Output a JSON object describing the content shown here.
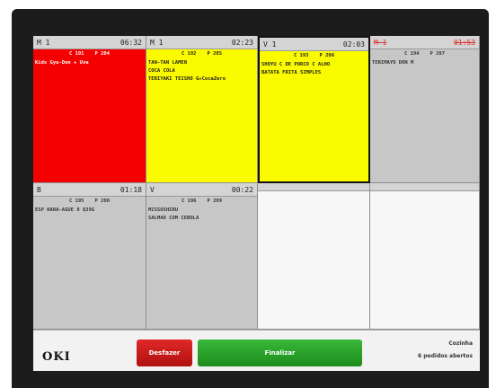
{
  "orders": [
    {
      "header_left": "M 1",
      "header_time": "06:32",
      "client": "C 191",
      "order": "P 204",
      "items": [
        "Kids Gyu-Don + Uva"
      ]
    },
    {
      "header_left": "M 1",
      "header_time": "02:23",
      "client": "C 192",
      "order": "P 205",
      "items": [
        "TAN-TAN LAMEN",
        "COCA COLA",
        "TERIYAKI TEISHO G+CocaZero"
      ]
    },
    {
      "header_left": "V 1",
      "header_time": "02:03",
      "client": "C 193",
      "order": "P 206",
      "items": [
        "SHOYU C DE PORCO C ALHO",
        "BATATA FRITA SIMPLES"
      ]
    },
    {
      "header_left": "M 1",
      "header_time": "01:53",
      "client": "C 194",
      "order": "P 207",
      "items": [
        "TERIMAYO DON M"
      ]
    },
    {
      "header_left": "B",
      "header_time": "01:18",
      "client": "C 195",
      "order": "P 208",
      "items": [
        "ESP KARA-AGUE 8 Q39G"
      ]
    },
    {
      "header_left": "V",
      "header_time": "00:22",
      "client": "C 196",
      "order": "P 209",
      "items": [
        "MISSOSHIRU",
        "SALMAO COM CEBOLA"
      ]
    }
  ],
  "footer": {
    "logo": "OKI",
    "undo_label": "Desfazer",
    "finish_label": "Finalizar",
    "station": "Cozinha",
    "open_orders": "6 pedidos abertos"
  },
  "colors": {
    "late": "#f40000",
    "warning": "#fbfb00",
    "normal": "#c7c7c7",
    "undo": "#c81818",
    "finish": "#2ea82e"
  }
}
